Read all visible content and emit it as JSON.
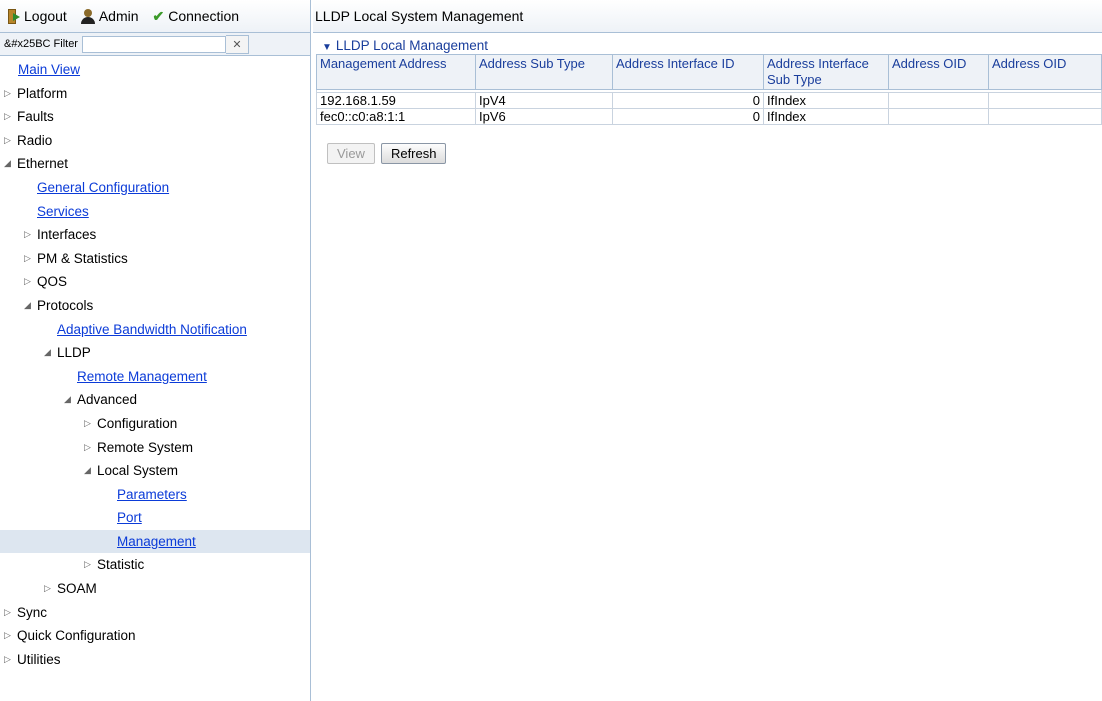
{
  "toolbar": {
    "logout": "Logout",
    "admin": "Admin",
    "connection": "Connection"
  },
  "filter": {
    "label": "&#x25BC Filter",
    "value": "",
    "clear_icon": "close-icon"
  },
  "tree": {
    "main_view": "Main View",
    "platform": "Platform",
    "faults": "Faults",
    "radio": "Radio",
    "ethernet": "Ethernet",
    "general_configuration": "General Configuration",
    "services": "Services",
    "interfaces": "Interfaces",
    "pm_statistics": "PM & Statistics",
    "qos": "QOS",
    "protocols": "Protocols",
    "adaptive_bandwidth": "Adaptive Bandwidth Notification",
    "lldp": "LLDP",
    "remote_management": "Remote Management",
    "advanced": "Advanced",
    "configuration": "Configuration",
    "remote_system": "Remote System",
    "local_system": "Local System",
    "parameters": "Parameters",
    "port": "Port",
    "management": "Management",
    "statistic": "Statistic",
    "soam": "SOAM",
    "sync": "Sync",
    "quick_configuration": "Quick Configuration",
    "utilities": "Utilities"
  },
  "page": {
    "title": "LLDP Local System Management",
    "section": "LLDP Local Management"
  },
  "table": {
    "headers": {
      "mgmt_address": "Management Address",
      "address_sub_type": "Address Sub Type",
      "address_interface_id": "Address Interface ID",
      "address_interface_sub_type": "Address Interface Sub Type",
      "address_oid_1": "Address OID",
      "address_oid_2": "Address OID"
    },
    "rows": [
      [
        "192.168.1.59",
        "IpV4",
        "0",
        "IfIndex",
        "",
        ""
      ],
      [
        "fec0::c0:a8:1:1",
        "IpV6",
        "0",
        "IfIndex",
        "",
        ""
      ]
    ]
  },
  "buttons": {
    "view": "View",
    "refresh": "Refresh"
  },
  "colors": {
    "link": "#0b3bd8",
    "header_text": "#1a3e9c",
    "border": "#a9bfd6",
    "selected_row": "#dde6f0"
  }
}
